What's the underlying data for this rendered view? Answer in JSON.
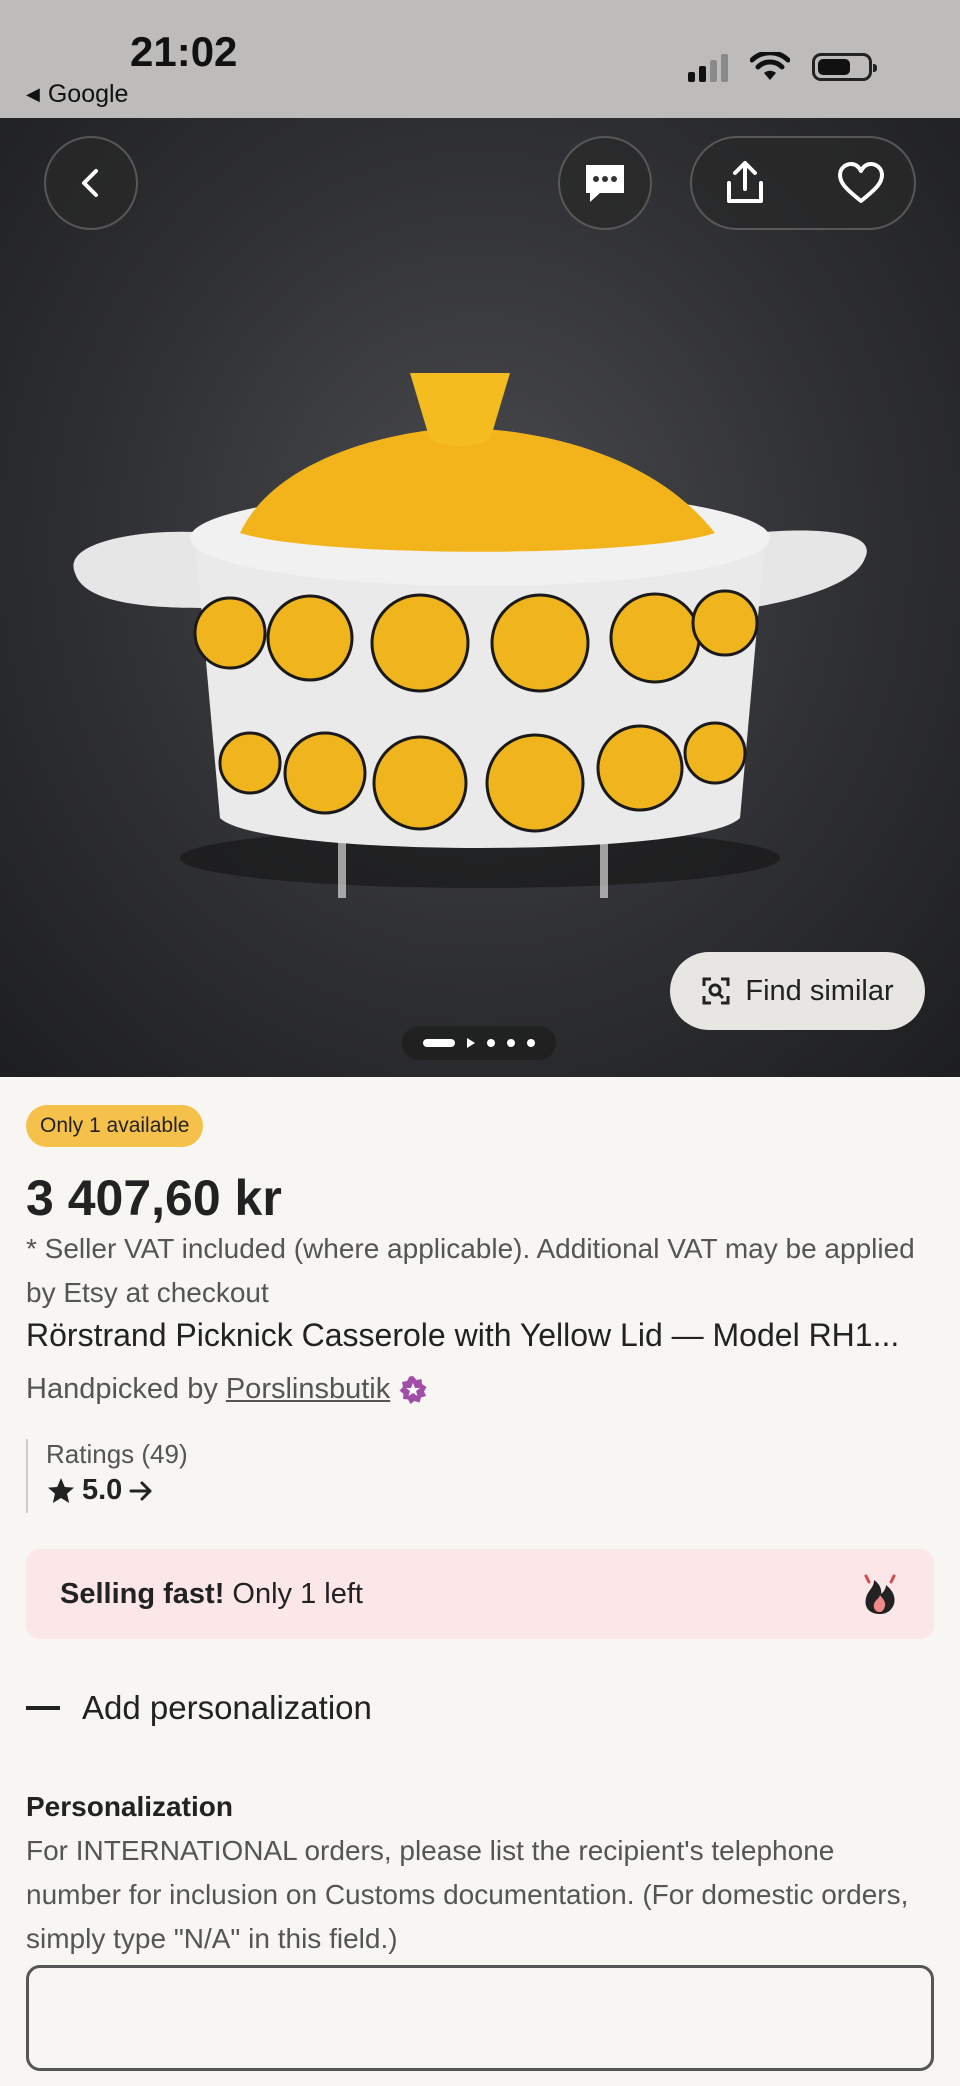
{
  "status_bar": {
    "time": "21:02",
    "back_app": "Google"
  },
  "hero": {
    "find_similar_label": "Find similar",
    "image_index": 1,
    "image_count": 5
  },
  "listing": {
    "availability_badge": "Only 1 available",
    "price": "3 407,60 kr",
    "vat_note": "* Seller VAT included (where applicable). Additional VAT may be applied by Etsy at checkout",
    "title": "Rörstrand Picknick Casserole with Yellow Lid — Model RH1...",
    "handpicked_prefix": "Handpicked by",
    "shop_name": "Porslinsbutik",
    "ratings_label": "Ratings (49)",
    "rating_value": "5.0"
  },
  "selling_fast": {
    "bold": "Selling fast!",
    "text": "Only 1 left"
  },
  "personalization": {
    "toggle_label": "Add personalization",
    "label": "Personalization",
    "description": "For INTERNATIONAL orders, please list the recipient's telephone number for inclusion on Customs documentation.  (For domestic orders, simply type \"N/A\" in this field.)",
    "input_value": ""
  },
  "colors": {
    "badge": "#f5c14a",
    "selling_bg": "#fbe6e8",
    "star_seller": "#a14ea8"
  }
}
